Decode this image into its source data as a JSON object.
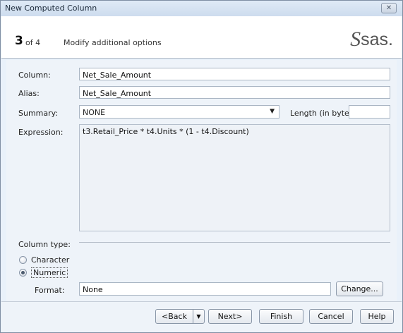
{
  "window": {
    "title": "New Computed Column",
    "close_label": "✕"
  },
  "header": {
    "step_number": "3",
    "step_of": "of 4",
    "step_description": "Modify additional options",
    "logo_mark": "S",
    "logo_text": "sas."
  },
  "form": {
    "column_label": "Column:",
    "column_value": "Net_Sale_Amount",
    "alias_label": "Alias:",
    "alias_value": "Net_Sale_Amount",
    "summary_label": "Summary:",
    "summary_value": "NONE",
    "length_label": "Length (in bytes):",
    "length_value": "",
    "expression_label": "Expression:",
    "expression_value": "t3.Retail_Price * t4.Units * (1 - t4.Discount)"
  },
  "column_type": {
    "section_label": "Column type:",
    "options": [
      {
        "label": "Character",
        "checked": false
      },
      {
        "label": "Numeric",
        "checked": true
      }
    ],
    "format_label": "Format:",
    "format_value": "None",
    "change_button": "Change..."
  },
  "footer": {
    "back_label": "<Back",
    "back_arrow": "▼",
    "next_label": "Next>",
    "finish_label": "Finish",
    "cancel_label": "Cancel",
    "help_label": "Help"
  }
}
